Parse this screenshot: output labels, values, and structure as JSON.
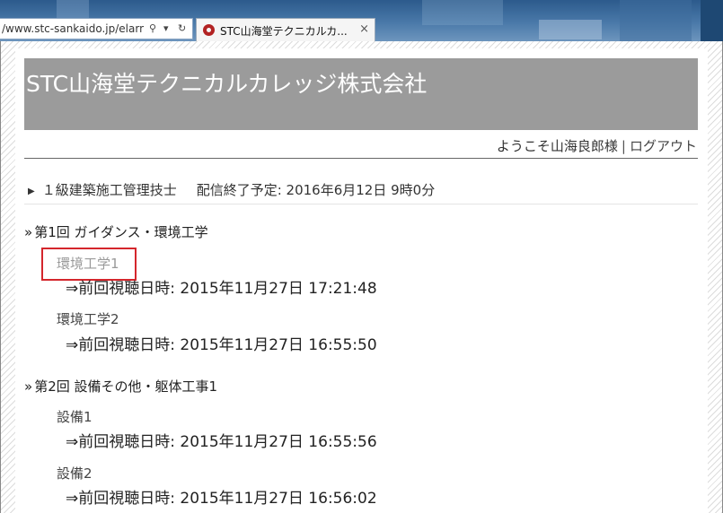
{
  "browser": {
    "url_fragment": "/www.stc-sankaido.jp/elarn",
    "tab_title": "STC山海堂テクニカルカ...",
    "tab_close": "×",
    "search_glyph": "⚲",
    "dropdown_glyph": "▾",
    "refresh_glyph": "↻"
  },
  "site": {
    "title": "STC山海堂テクニカルカレッジ株式会社"
  },
  "user_bar": {
    "welcome": "ようこそ山海良郎様",
    "separator": "|",
    "logout": "ログアウト"
  },
  "course": {
    "name": "１級建築施工管理技士",
    "delivery_end": "配信終了予定: 2016年6月12日  9時0分"
  },
  "sessions": [
    {
      "heading": "第1回  ガイダンス・環境工学",
      "lessons": [
        {
          "title": "環境工学1",
          "last_viewed": "⇒前回視聴日時: 2015年11月27日  17:21:48"
        },
        {
          "title": "環境工学2",
          "last_viewed": "⇒前回視聴日時: 2015年11月27日  16:55:50"
        }
      ]
    },
    {
      "heading": "第2回  設備その他・躯体工事1",
      "lessons": [
        {
          "title": "設備1",
          "last_viewed": "⇒前回視聴日時: 2015年11月27日  16:55:56"
        },
        {
          "title": "設備2",
          "last_viewed": "⇒前回視聴日時: 2015年11月27日  16:56:02"
        }
      ]
    }
  ],
  "colors": {
    "banner": "#9b9b9b",
    "highlight_box": "#d4262c"
  }
}
